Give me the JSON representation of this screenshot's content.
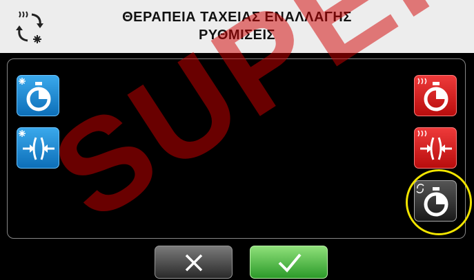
{
  "header": {
    "title_line1": "ΘΕΡΑΠΕΙΑ ΤΑΧΕΙΑΣ ΕΝΑΛΛΑΓΗΣ",
    "title_line2": "ΡΥΘΜΙΣΕΙΣ",
    "icon": "hot-cold-switch-icon"
  },
  "tiles": {
    "left": [
      {
        "icon": "cold-timer-icon",
        "color": "#1e88d4"
      },
      {
        "icon": "cold-compression-icon",
        "color": "#1e88d4"
      }
    ],
    "right": [
      {
        "icon": "hot-timer-icon",
        "color": "#d81e1e"
      },
      {
        "icon": "hot-compression-icon",
        "color": "#d81e1e"
      },
      {
        "icon": "cycle-timer-icon",
        "color": "#333333",
        "highlighted": true
      }
    ]
  },
  "footer": {
    "cancel_icon": "close-icon",
    "confirm_icon": "checkmark-icon"
  },
  "watermark": "SUPER",
  "colors": {
    "header_bg": "#ededed",
    "blue": "#1e88d4",
    "red": "#d81e1e",
    "green": "#4cbc3a",
    "highlight": "#f2e500"
  }
}
